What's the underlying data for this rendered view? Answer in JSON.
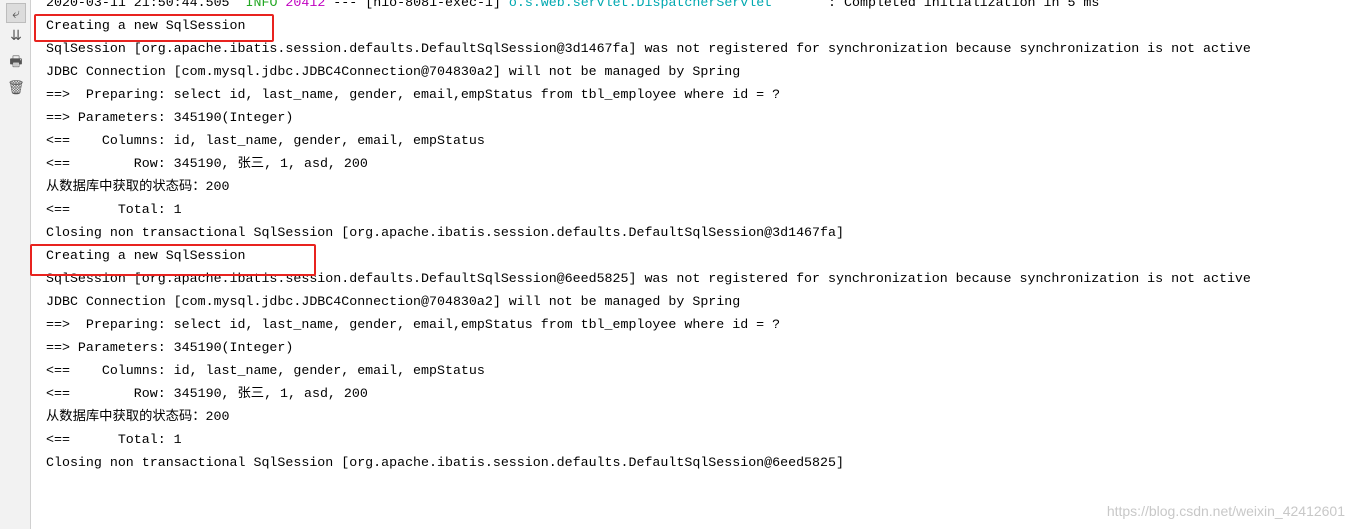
{
  "toolbar": {
    "icons": [
      "soft-wrap-icon",
      "scroll-to-end-icon",
      "print-icon",
      "trash-icon"
    ]
  },
  "header_line": {
    "timestamp": "2020-03-11 21:50:44.505",
    "level": "INFO",
    "pid": "20412",
    "sep": "---",
    "thread": "[nio-8081-exec-1]",
    "logger": "o.s.web.servlet.DispatcherServlet",
    "message": "       : Completed initialization in 5 ms"
  },
  "colors": {
    "info": "#22a722",
    "pid": "#c000c0",
    "logger": "#00a8b0",
    "highlight": "#e8231f"
  },
  "lines": [
    "Creating a new SqlSession",
    "SqlSession [org.apache.ibatis.session.defaults.DefaultSqlSession@3d1467fa] was not registered for synchronization because synchronization is not active",
    "JDBC Connection [com.mysql.jdbc.JDBC4Connection@704830a2] will not be managed by Spring",
    "==>  Preparing: select id, last_name, gender, email,empStatus from tbl_employee where id = ?",
    "==> Parameters: 345190(Integer)",
    "<==    Columns: id, last_name, gender, email, empStatus",
    "<==        Row: 345190, 张三, 1, asd, 200",
    "从数据库中获取的状态码：200",
    "<==      Total: 1",
    "Closing non transactional SqlSession [org.apache.ibatis.session.defaults.DefaultSqlSession@3d1467fa]",
    "Creating a new SqlSession",
    "SqlSession [org.apache.ibatis.session.defaults.DefaultSqlSession@6eed5825] was not registered for synchronization because synchronization is not active",
    "JDBC Connection [com.mysql.jdbc.JDBC4Connection@704830a2] will not be managed by Spring",
    "==>  Preparing: select id, last_name, gender, email,empStatus from tbl_employee where id = ?",
    "==> Parameters: 345190(Integer)",
    "<==    Columns: id, last_name, gender, email, empStatus",
    "<==        Row: 345190, 张三, 1, asd, 200",
    "从数据库中获取的状态码：200",
    "<==      Total: 1",
    "Closing non transactional SqlSession [org.apache.ibatis.session.defaults.DefaultSqlSession@6eed5825]"
  ],
  "watermark": "https://blog.csdn.net/weixin_42412601"
}
